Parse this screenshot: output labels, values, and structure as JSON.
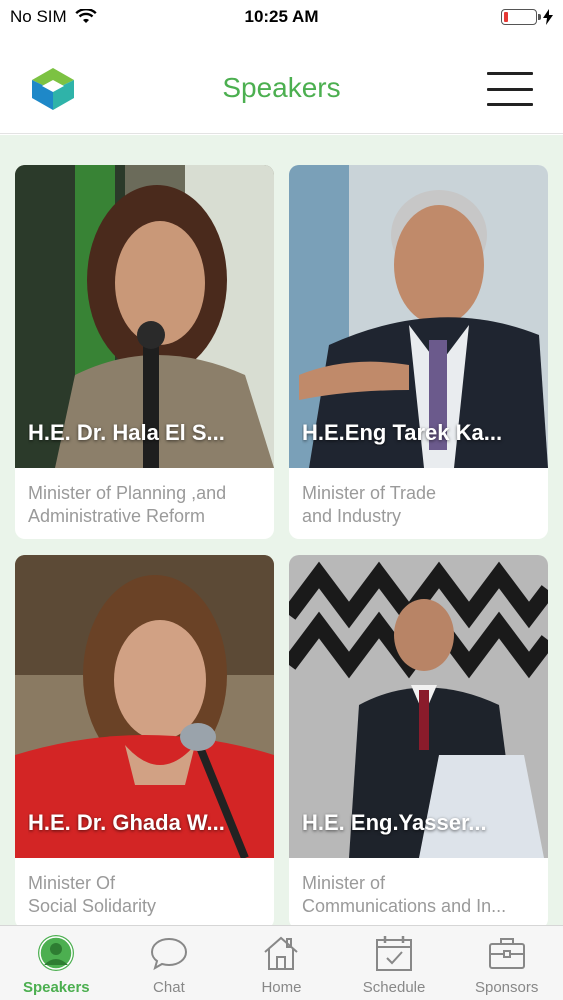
{
  "status_bar": {
    "carrier": "No SIM",
    "time": "10:25 AM"
  },
  "header": {
    "title": "Speakers",
    "menu_icon": "hamburger-menu-icon",
    "logo_icon": "app-logo-icon"
  },
  "colors": {
    "accent": "#4caf50",
    "content_bg": "#eaf4ea",
    "battery_low": "#e53935"
  },
  "speakers": [
    {
      "name": "H.E. Dr. Hala El S...",
      "title_line1": "Minister of Planning ,and",
      "title_line2": "Administrative Reform"
    },
    {
      "name": "H.E.Eng Tarek Ka...",
      "title_line1": "Minister of Trade",
      "title_line2": "and Industry"
    },
    {
      "name": "H.E. Dr. Ghada W...",
      "title_line1": "Minister Of",
      "title_line2": "Social Solidarity"
    },
    {
      "name": "H.E. Eng.Yasser...",
      "title_line1": "Minister of",
      "title_line2": "Communications and In..."
    }
  ],
  "tabs": [
    {
      "label": "Speakers",
      "icon": "person-icon",
      "active": true
    },
    {
      "label": "Chat",
      "icon": "chat-bubble-icon",
      "active": false
    },
    {
      "label": "Home",
      "icon": "home-icon",
      "active": false
    },
    {
      "label": "Schedule",
      "icon": "calendar-icon",
      "active": false
    },
    {
      "label": "Sponsors",
      "icon": "briefcase-icon",
      "active": false
    }
  ]
}
